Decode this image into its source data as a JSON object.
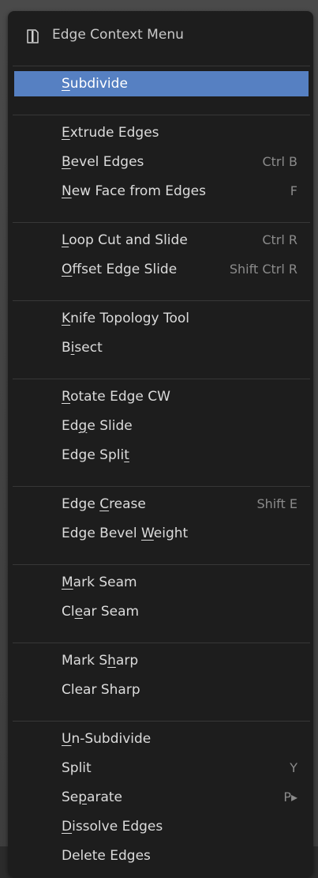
{
  "menu": {
    "title": "Edge Context Menu",
    "icon": "edge-mode-icon",
    "active_color": "#5680c2",
    "groups": [
      [
        {
          "pre": "",
          "u": "S",
          "post": "ubdivide",
          "shortcut": "",
          "active": true
        }
      ],
      [
        {
          "pre": "",
          "u": "E",
          "post": "xtrude Edges",
          "shortcut": ""
        },
        {
          "pre": "",
          "u": "B",
          "post": "evel Edges",
          "shortcut": "Ctrl B"
        },
        {
          "pre": "",
          "u": "N",
          "post": "ew Face from Edges",
          "shortcut": "F"
        }
      ],
      [
        {
          "pre": "",
          "u": "L",
          "post": "oop Cut and Slide",
          "shortcut": "Ctrl R"
        },
        {
          "pre": "",
          "u": "O",
          "post": "ffset Edge Slide",
          "shortcut": "Shift Ctrl R"
        }
      ],
      [
        {
          "pre": "",
          "u": "K",
          "post": "nife Topology Tool",
          "shortcut": ""
        },
        {
          "pre": "B",
          "u": "i",
          "post": "sect",
          "shortcut": ""
        }
      ],
      [
        {
          "pre": "",
          "u": "R",
          "post": "otate Edge CW",
          "shortcut": ""
        },
        {
          "pre": "Ed",
          "u": "g",
          "post": "e Slide",
          "shortcut": ""
        },
        {
          "pre": "Edge Spli",
          "u": "t",
          "post": "",
          "shortcut": ""
        }
      ],
      [
        {
          "pre": "Edge ",
          "u": "C",
          "post": "rease",
          "shortcut": "Shift E"
        },
        {
          "pre": "Edge Bevel ",
          "u": "W",
          "post": "eight",
          "shortcut": ""
        }
      ],
      [
        {
          "pre": "",
          "u": "M",
          "post": "ark Seam",
          "shortcut": ""
        },
        {
          "pre": "Cl",
          "u": "e",
          "post": "ar Seam",
          "shortcut": ""
        }
      ],
      [
        {
          "pre": "Mark S",
          "u": "h",
          "post": "arp",
          "shortcut": ""
        },
        {
          "pre": "Clear Sharp",
          "u": "",
          "post": "",
          "shortcut": ""
        }
      ],
      [
        {
          "pre": "",
          "u": "U",
          "post": "n-Subdivide",
          "shortcut": ""
        },
        {
          "pre": "Split",
          "u": "",
          "post": "",
          "shortcut": "Y"
        },
        {
          "pre": "Se",
          "u": "p",
          "post": "arate",
          "shortcut": "P▸"
        },
        {
          "pre": "",
          "u": "D",
          "post": "issolve Edges",
          "shortcut": ""
        },
        {
          "pre": "Delete Edges",
          "u": "",
          "post": "",
          "shortcut": ""
        }
      ]
    ]
  }
}
